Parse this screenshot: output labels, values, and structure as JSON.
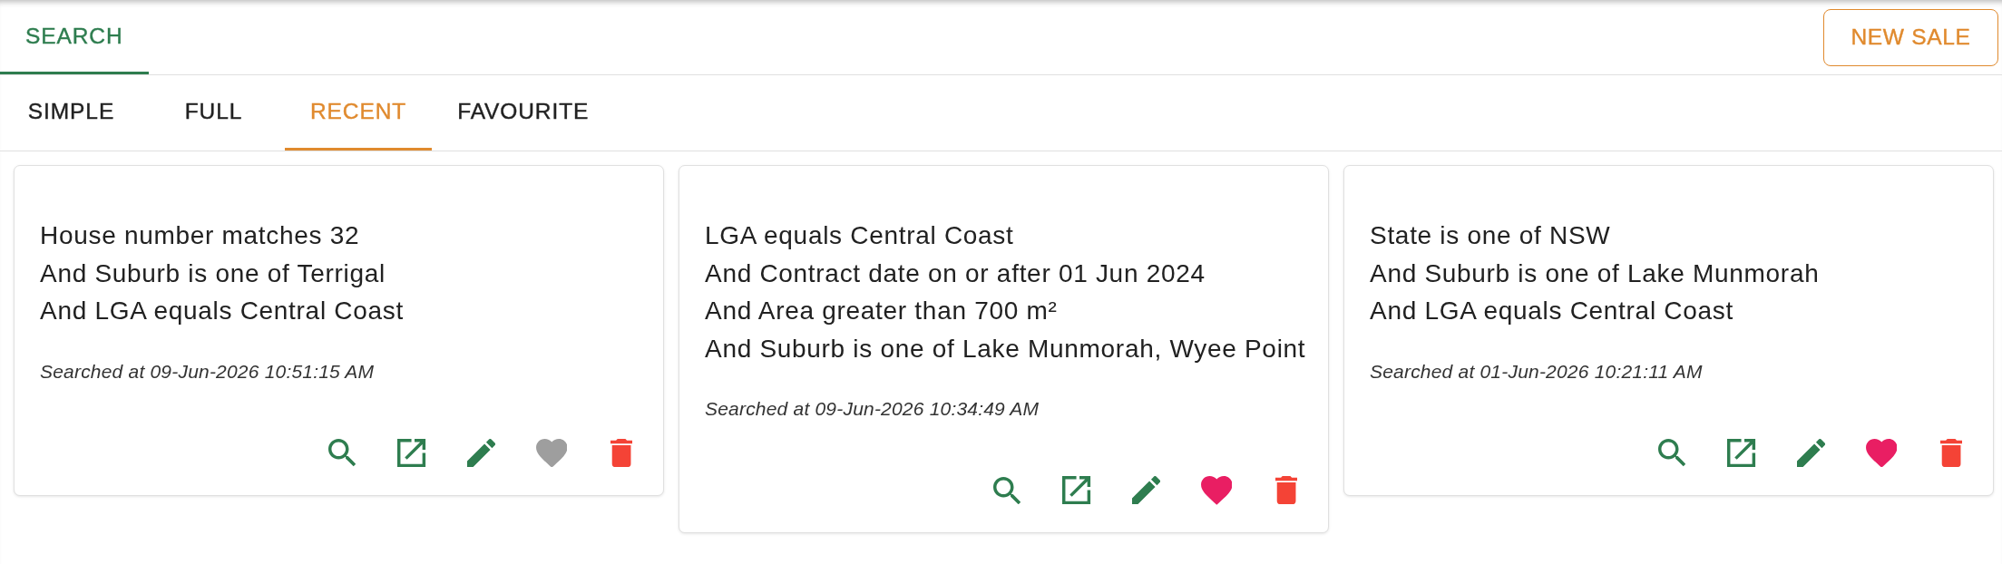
{
  "top_tabs": [
    {
      "label": "SEARCH",
      "selected": true
    }
  ],
  "new_sale_button": {
    "label": "NEW SALE"
  },
  "search_tabs": [
    {
      "label": "SIMPLE",
      "selected": false
    },
    {
      "label": "FULL",
      "selected": false
    },
    {
      "label": "RECENT",
      "selected": true
    },
    {
      "label": "FAVOURITE",
      "selected": false
    }
  ],
  "recent_searches": [
    {
      "criteria": [
        "House number matches 32",
        "And Suburb is one of Terrigal",
        "And LGA equals Central Coast"
      ],
      "searched_at": "Searched at 09-Jun-2026 10:51:15 AM",
      "favourite": false
    },
    {
      "criteria": [
        "LGA equals Central Coast",
        "And Contract date on or after 01 Jun 2024",
        "And Area greater than 700 m²",
        "And Suburb is one of Lake Munmorah, Wyee Point"
      ],
      "searched_at": "Searched at 09-Jun-2026 10:34:49 AM",
      "favourite": true
    },
    {
      "criteria": [
        "State is one of NSW",
        "And Suburb is one of Lake Munmorah",
        "And LGA equals Central Coast"
      ],
      "searched_at": "Searched at 01-Jun-2026 10:21:11 AM",
      "favourite": true
    }
  ]
}
